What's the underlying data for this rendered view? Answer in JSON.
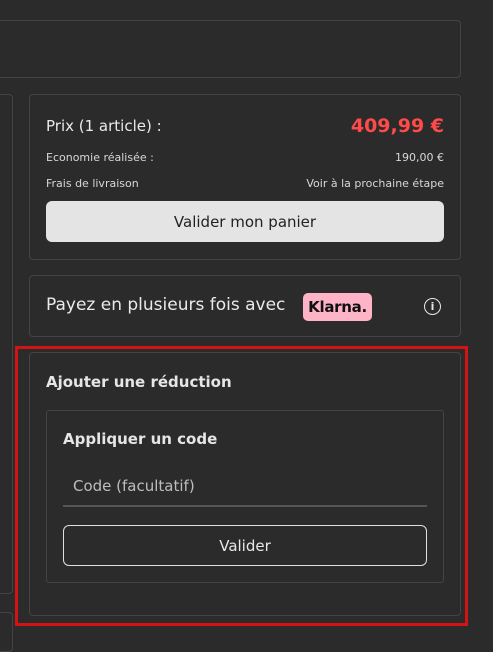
{
  "summary": {
    "price_label": "Prix (1 article) :",
    "price_amount": "409,99 €",
    "savings_label": "Economie réalisée :",
    "savings_amount": "190,00 €",
    "shipping_label": "Frais de livraison",
    "shipping_value": "Voir à la prochaine étape",
    "validate_cart_label": "Valider mon panier"
  },
  "klarna": {
    "text": "Payez en plusieurs fois avec",
    "badge": "Klarna.",
    "info_icon": "info-icon"
  },
  "discount": {
    "title": "Ajouter une réduction",
    "code_title": "Appliquer un code",
    "code_placeholder": "Code (facultatif)",
    "code_value": "",
    "validate_label": "Valider"
  },
  "colors": {
    "background": "#2b2b2b",
    "price_accent": "#ff4a4a",
    "klarna_pink": "#ffb3c7",
    "highlight_red": "#d41414"
  }
}
